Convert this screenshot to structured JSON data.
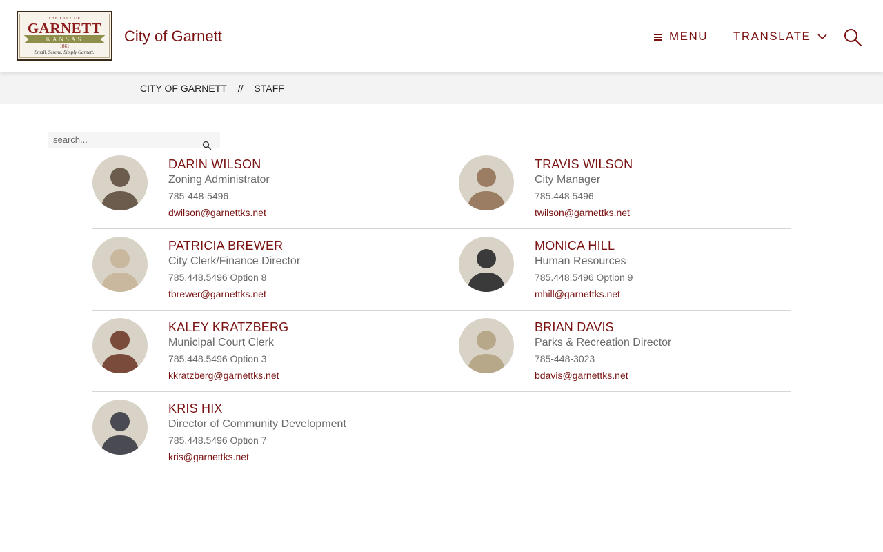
{
  "header": {
    "logo": {
      "top": "THE CITY OF",
      "main": "GARNETT",
      "ribbon": "KANSAS",
      "year": "1861",
      "tagline": "Small. Serene. Simply Garnett."
    },
    "site_title": "City of Garnett",
    "menu_label": "MENU",
    "translate_label": "TRANSLATE",
    "search_icon": "search-icon"
  },
  "breadcrumb": {
    "home": "CITY OF GARNETT",
    "separator": "//",
    "current": "STAFF"
  },
  "search": {
    "placeholder": "search...",
    "value": ""
  },
  "colors": {
    "brand": "#7a1212",
    "muted_text": "#6a6a6a",
    "breadcrumb_bg": "#f3f3f3"
  },
  "staff": [
    {
      "name": "DARIN WILSON",
      "title": "Zoning Administrator",
      "phone": "785-448-5496",
      "email": "dwilson@garnettks.net",
      "photo_tone": "#6b5c4e"
    },
    {
      "name": "TRAVIS WILSON",
      "title": "City Manager",
      "phone": "785.448.5496",
      "email": "twilson@garnettks.net",
      "photo_tone": "#9a7d62"
    },
    {
      "name": "PATRICIA BREWER",
      "title": "City Clerk/Finance Director",
      "phone": "785.448.5496 Option 8",
      "email": "tbrewer@garnettks.net",
      "photo_tone": "#c9b79e"
    },
    {
      "name": "MONICA HILL",
      "title": "Human Resources",
      "phone": "785.448.5496 Option 9",
      "email": "mhill@garnettks.net",
      "photo_tone": "#3a3a3a"
    },
    {
      "name": "KALEY KRATZBERG",
      "title": "Municipal Court Clerk",
      "phone": "785.448.5496 Option 3",
      "email": "kkratzberg@garnettks.net",
      "photo_tone": "#7a4a3a"
    },
    {
      "name": "BRIAN DAVIS",
      "title": "Parks & Recreation Director",
      "phone": "785-448-3023",
      "email": "bdavis@garnettks.net",
      "photo_tone": "#b8a88a"
    },
    {
      "name": "KRIS HIX",
      "title": "Director of Community Development",
      "phone": "785.448.5496 Option 7",
      "email": "kris@garnettks.net",
      "photo_tone": "#4a4a52"
    }
  ]
}
